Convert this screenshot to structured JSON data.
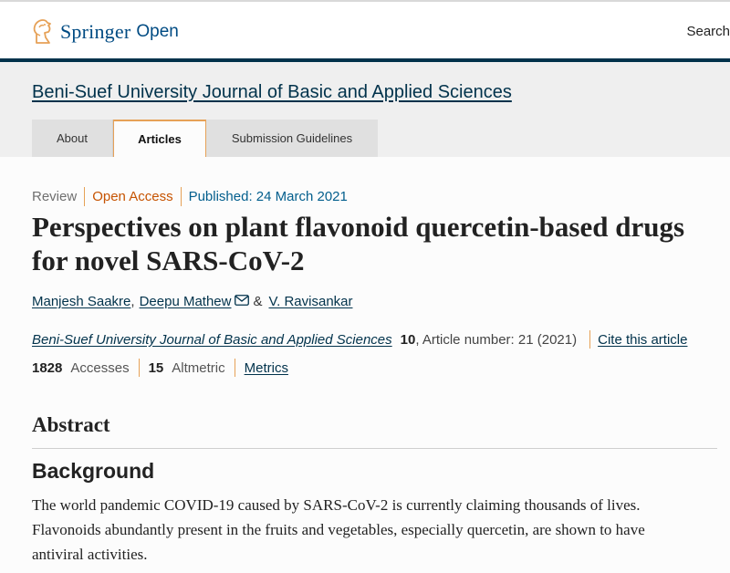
{
  "brand": {
    "name": "Springer",
    "suffix": "Open",
    "color": "#004b83",
    "accent": "#e6a157"
  },
  "header": {
    "search_label": "Search"
  },
  "journal": {
    "title": "Beni-Suef University Journal of Basic and Applied Sciences",
    "tabs": [
      {
        "label": "About",
        "active": false
      },
      {
        "label": "Articles",
        "active": true
      },
      {
        "label": "Submission Guidelines",
        "active": false
      }
    ]
  },
  "article": {
    "type": "Review",
    "access": "Open Access",
    "published": "Published: 24 March 2021",
    "title": "Perspectives on plant flavonoid quercetin-based drugs for novel SARS-CoV-2",
    "authors": [
      {
        "name": "Manjesh Saakre",
        "sep": ","
      },
      {
        "name": "Deepu Mathew",
        "sep": "",
        "icon": "mail-icon"
      },
      {
        "name": "V. Ravisankar",
        "sep": ""
      }
    ],
    "and": "&",
    "citation": {
      "journal": "Beni-Suef University Journal of Basic and Applied Sciences",
      "volume": "10",
      "rest": ", Article number: 21 (2021)",
      "cite_label": "Cite this article"
    },
    "metrics": {
      "accesses_value": "1828",
      "accesses_label": "Accesses",
      "altmetric_value": "15",
      "altmetric_label": "Altmetric",
      "metrics_link": "Metrics"
    }
  },
  "abstract": {
    "heading": "Abstract",
    "section_heading": "Background",
    "text": "The world pandemic COVID-19 caused by SARS-CoV-2 is currently claiming thousands of lives. Flavonoids abundantly present in the fruits and vegetables, especially quercetin, are shown to have antiviral activities."
  }
}
